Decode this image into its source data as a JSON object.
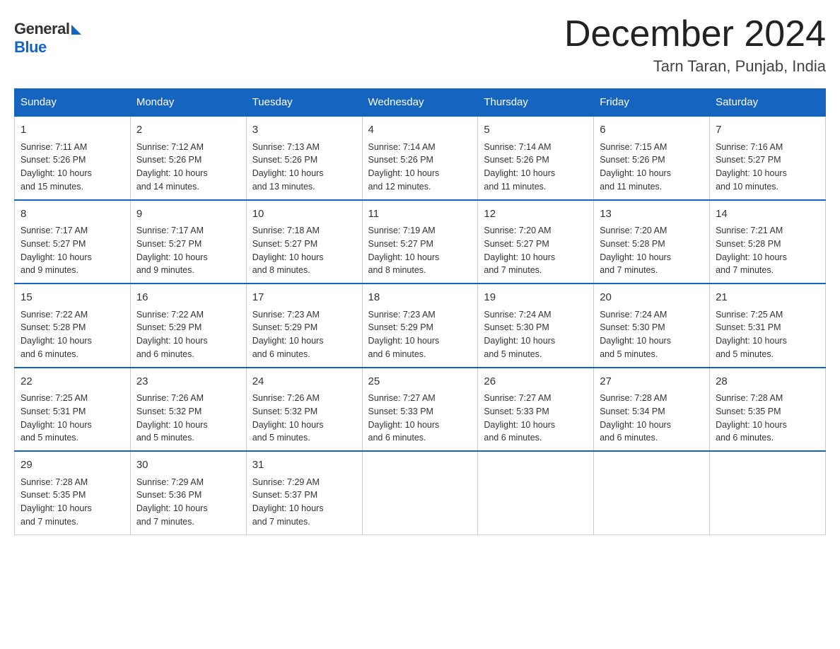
{
  "logo": {
    "general": "General",
    "blue": "Blue"
  },
  "title": "December 2024",
  "subtitle": "Tarn Taran, Punjab, India",
  "days_of_week": [
    "Sunday",
    "Monday",
    "Tuesday",
    "Wednesday",
    "Thursday",
    "Friday",
    "Saturday"
  ],
  "weeks": [
    [
      {
        "num": "1",
        "info": "Sunrise: 7:11 AM\nSunset: 5:26 PM\nDaylight: 10 hours\nand 15 minutes."
      },
      {
        "num": "2",
        "info": "Sunrise: 7:12 AM\nSunset: 5:26 PM\nDaylight: 10 hours\nand 14 minutes."
      },
      {
        "num": "3",
        "info": "Sunrise: 7:13 AM\nSunset: 5:26 PM\nDaylight: 10 hours\nand 13 minutes."
      },
      {
        "num": "4",
        "info": "Sunrise: 7:14 AM\nSunset: 5:26 PM\nDaylight: 10 hours\nand 12 minutes."
      },
      {
        "num": "5",
        "info": "Sunrise: 7:14 AM\nSunset: 5:26 PM\nDaylight: 10 hours\nand 11 minutes."
      },
      {
        "num": "6",
        "info": "Sunrise: 7:15 AM\nSunset: 5:26 PM\nDaylight: 10 hours\nand 11 minutes."
      },
      {
        "num": "7",
        "info": "Sunrise: 7:16 AM\nSunset: 5:27 PM\nDaylight: 10 hours\nand 10 minutes."
      }
    ],
    [
      {
        "num": "8",
        "info": "Sunrise: 7:17 AM\nSunset: 5:27 PM\nDaylight: 10 hours\nand 9 minutes."
      },
      {
        "num": "9",
        "info": "Sunrise: 7:17 AM\nSunset: 5:27 PM\nDaylight: 10 hours\nand 9 minutes."
      },
      {
        "num": "10",
        "info": "Sunrise: 7:18 AM\nSunset: 5:27 PM\nDaylight: 10 hours\nand 8 minutes."
      },
      {
        "num": "11",
        "info": "Sunrise: 7:19 AM\nSunset: 5:27 PM\nDaylight: 10 hours\nand 8 minutes."
      },
      {
        "num": "12",
        "info": "Sunrise: 7:20 AM\nSunset: 5:27 PM\nDaylight: 10 hours\nand 7 minutes."
      },
      {
        "num": "13",
        "info": "Sunrise: 7:20 AM\nSunset: 5:28 PM\nDaylight: 10 hours\nand 7 minutes."
      },
      {
        "num": "14",
        "info": "Sunrise: 7:21 AM\nSunset: 5:28 PM\nDaylight: 10 hours\nand 7 minutes."
      }
    ],
    [
      {
        "num": "15",
        "info": "Sunrise: 7:22 AM\nSunset: 5:28 PM\nDaylight: 10 hours\nand 6 minutes."
      },
      {
        "num": "16",
        "info": "Sunrise: 7:22 AM\nSunset: 5:29 PM\nDaylight: 10 hours\nand 6 minutes."
      },
      {
        "num": "17",
        "info": "Sunrise: 7:23 AM\nSunset: 5:29 PM\nDaylight: 10 hours\nand 6 minutes."
      },
      {
        "num": "18",
        "info": "Sunrise: 7:23 AM\nSunset: 5:29 PM\nDaylight: 10 hours\nand 6 minutes."
      },
      {
        "num": "19",
        "info": "Sunrise: 7:24 AM\nSunset: 5:30 PM\nDaylight: 10 hours\nand 5 minutes."
      },
      {
        "num": "20",
        "info": "Sunrise: 7:24 AM\nSunset: 5:30 PM\nDaylight: 10 hours\nand 5 minutes."
      },
      {
        "num": "21",
        "info": "Sunrise: 7:25 AM\nSunset: 5:31 PM\nDaylight: 10 hours\nand 5 minutes."
      }
    ],
    [
      {
        "num": "22",
        "info": "Sunrise: 7:25 AM\nSunset: 5:31 PM\nDaylight: 10 hours\nand 5 minutes."
      },
      {
        "num": "23",
        "info": "Sunrise: 7:26 AM\nSunset: 5:32 PM\nDaylight: 10 hours\nand 5 minutes."
      },
      {
        "num": "24",
        "info": "Sunrise: 7:26 AM\nSunset: 5:32 PM\nDaylight: 10 hours\nand 5 minutes."
      },
      {
        "num": "25",
        "info": "Sunrise: 7:27 AM\nSunset: 5:33 PM\nDaylight: 10 hours\nand 6 minutes."
      },
      {
        "num": "26",
        "info": "Sunrise: 7:27 AM\nSunset: 5:33 PM\nDaylight: 10 hours\nand 6 minutes."
      },
      {
        "num": "27",
        "info": "Sunrise: 7:28 AM\nSunset: 5:34 PM\nDaylight: 10 hours\nand 6 minutes."
      },
      {
        "num": "28",
        "info": "Sunrise: 7:28 AM\nSunset: 5:35 PM\nDaylight: 10 hours\nand 6 minutes."
      }
    ],
    [
      {
        "num": "29",
        "info": "Sunrise: 7:28 AM\nSunset: 5:35 PM\nDaylight: 10 hours\nand 7 minutes."
      },
      {
        "num": "30",
        "info": "Sunrise: 7:29 AM\nSunset: 5:36 PM\nDaylight: 10 hours\nand 7 minutes."
      },
      {
        "num": "31",
        "info": "Sunrise: 7:29 AM\nSunset: 5:37 PM\nDaylight: 10 hours\nand 7 minutes."
      },
      null,
      null,
      null,
      null
    ]
  ]
}
